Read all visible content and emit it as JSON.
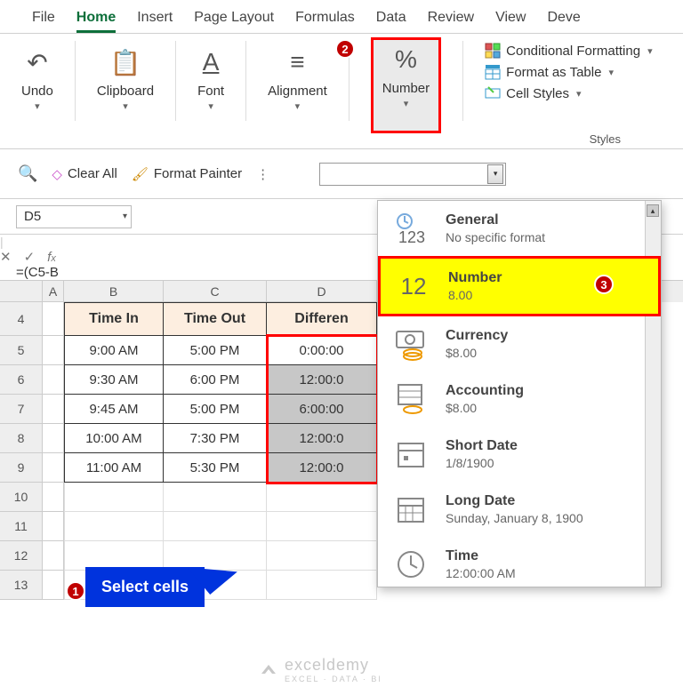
{
  "ribbon": {
    "tabs": [
      "File",
      "Home",
      "Insert",
      "Page Layout",
      "Formulas",
      "Data",
      "Review",
      "View",
      "Deve"
    ],
    "active": "Home",
    "groups": {
      "undo": "Undo",
      "clipboard": "Clipboard",
      "font": "Font",
      "alignment": "Alignment",
      "number": "Number",
      "styles_label": "Styles",
      "cond_format": "Conditional Formatting",
      "format_table": "Format as Table",
      "cell_styles": "Cell Styles"
    }
  },
  "toolbar": {
    "clear_all": "Clear All",
    "format_painter": "Format Painter"
  },
  "formula": {
    "name_box": "D5",
    "formula_text": "=(C5-B"
  },
  "grid": {
    "col_headers": [
      "A",
      "B",
      "C",
      "D"
    ],
    "row_numbers": [
      "4",
      "5",
      "6",
      "7",
      "8",
      "9",
      "10",
      "11",
      "12",
      "13"
    ],
    "header_row": {
      "b": "Time In",
      "c": "Time Out",
      "d": "Differen"
    },
    "rows": [
      {
        "b": "9:00 AM",
        "c": "5:00 PM",
        "d": "0:00:00"
      },
      {
        "b": "9:30 AM",
        "c": "6:00 PM",
        "d": "12:00:0"
      },
      {
        "b": "9:45 AM",
        "c": "5:00 PM",
        "d": "6:00:00"
      },
      {
        "b": "10:00 AM",
        "c": "7:30 PM",
        "d": "12:00:0"
      },
      {
        "b": "11:00 AM",
        "c": "5:30 PM",
        "d": "12:00:0"
      }
    ]
  },
  "dropdown": {
    "items": [
      {
        "title": "General",
        "sub": "No specific format",
        "icon": "123"
      },
      {
        "title": "Number",
        "sub": "8.00",
        "icon": "12",
        "highlight": true
      },
      {
        "title": "Currency",
        "sub": "$8.00",
        "icon": "cur"
      },
      {
        "title": "Accounting",
        "sub": "$8.00",
        "icon": "acc"
      },
      {
        "title": "Short Date",
        "sub": "1/8/1900",
        "icon": "cal"
      },
      {
        "title": "Long Date",
        "sub": "Sunday, January 8, 1900",
        "icon": "cal2"
      },
      {
        "title": "Time",
        "sub": "12:00:00 AM",
        "icon": "clock"
      }
    ]
  },
  "annotations": {
    "callout": "Select cells",
    "badge1": "1",
    "badge2": "2",
    "badge3": "3"
  },
  "watermark": {
    "main": "exceldemy",
    "sub": "EXCEL · DATA · BI"
  }
}
